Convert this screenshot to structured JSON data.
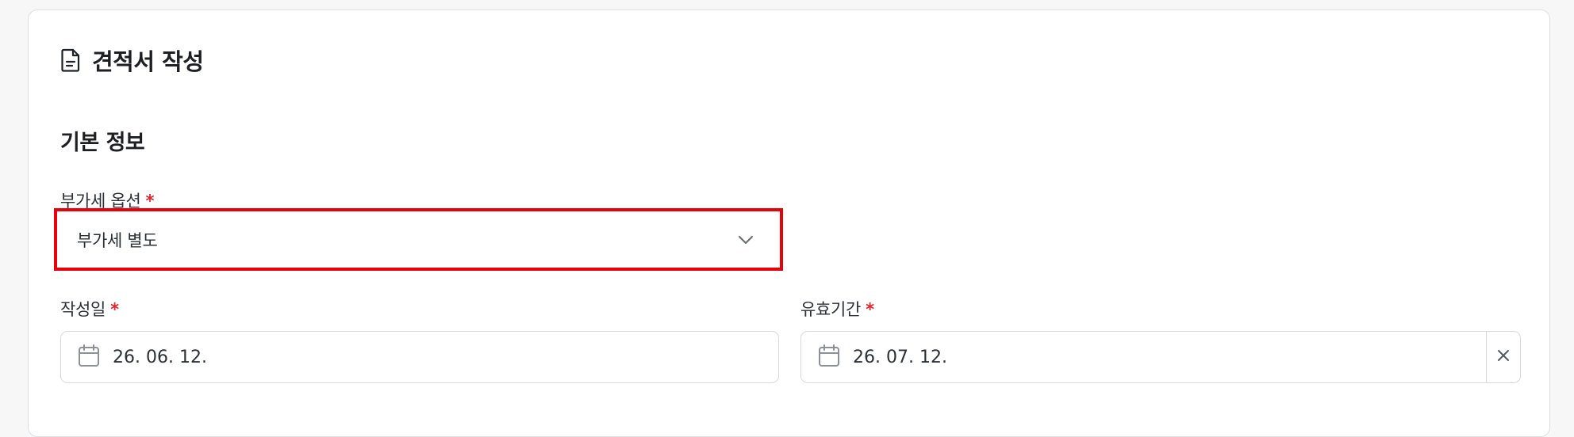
{
  "form": {
    "title": "견적서 작성",
    "title_icon": "document-icon"
  },
  "basic_info": {
    "section_title": "기본 정보",
    "vat_option": {
      "label": "부가세 옵션",
      "required_mark": "*",
      "selected_value": "부가세 별도",
      "icon": "chevron-down-icon"
    },
    "created_date": {
      "label": "작성일",
      "required_mark": "*",
      "value": "26. 06. 12.",
      "icon": "calendar-icon"
    },
    "valid_until": {
      "label": "유효기간",
      "required_mark": "*",
      "value": "26. 07. 12.",
      "icon": "calendar-icon",
      "clear_icon": "close-icon"
    }
  },
  "colors": {
    "highlight": "#e8000a",
    "required": "#e5232b",
    "border": "#d6d9de",
    "icon_gray": "#8b9099"
  }
}
